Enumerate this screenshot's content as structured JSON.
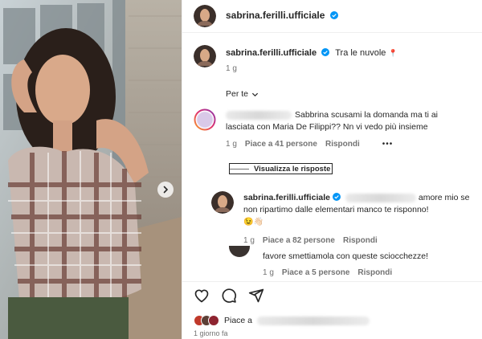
{
  "post": {
    "author": "sabrina.ferilli.ufficiale",
    "caption": "Tra le nuvole",
    "caption_time": "1 g",
    "emoji_pin": "📍"
  },
  "sort_label": "Per te",
  "comments": [
    {
      "text": "Sabbrina scusami la domanda ma ti ai lasciata con Maria De Filippi?? Nn vi vedo più insieme",
      "time": "1 g",
      "likes": "Piace a 41 persone",
      "reply": "Rispondi",
      "more": "•••",
      "view_replies": "Visualizza le risposte"
    }
  ],
  "replies": [
    {
      "author": "sabrina.ferilli.ufficiale",
      "text": "amore mio se non ripartimo dalle elementari manco te risponno!",
      "emojis": "😉👋🏻",
      "time": "1 g",
      "likes": "Piace a 82 persone",
      "reply": "Rispondi"
    },
    {
      "text": "favore smettiamola con queste sciocchezze!",
      "time": "1 g",
      "likes": "Piace a 5 persone",
      "reply": "Rispondi"
    }
  ],
  "likes_summary": "Piace a",
  "post_age": "1 giorno fa",
  "colors": {
    "verified": "#0095f6",
    "muted": "#737373",
    "text": "#262626"
  }
}
